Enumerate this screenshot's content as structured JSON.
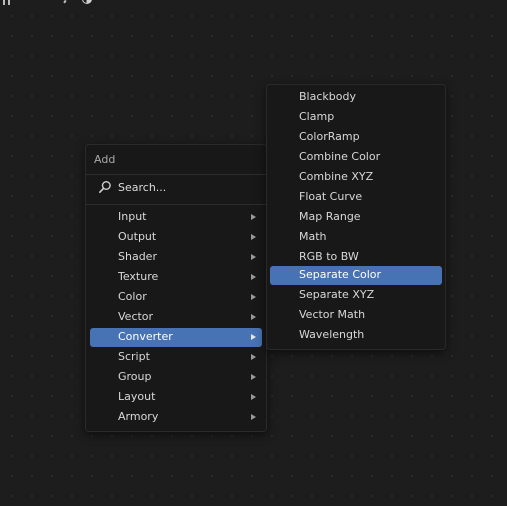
{
  "colors": {
    "background": "#1d1d1d",
    "menu_background": "#181818",
    "highlight": "#4772b3",
    "text": "#d8d8d8"
  },
  "add_menu": {
    "title": "Add",
    "search_label": "Search...",
    "search_icon": "search-icon",
    "items": [
      {
        "label": "Input",
        "has_submenu": true
      },
      {
        "label": "Output",
        "has_submenu": true
      },
      {
        "label": "Shader",
        "has_submenu": true
      },
      {
        "label": "Texture",
        "has_submenu": true
      },
      {
        "label": "Color",
        "has_submenu": true
      },
      {
        "label": "Vector",
        "has_submenu": true
      },
      {
        "label": "Converter",
        "has_submenu": true,
        "active": true
      },
      {
        "label": "Script",
        "has_submenu": true
      },
      {
        "label": "Group",
        "has_submenu": true
      },
      {
        "label": "Layout",
        "has_submenu": true
      },
      {
        "label": "Armory",
        "has_submenu": true
      }
    ]
  },
  "converter_menu": {
    "items": [
      {
        "label": "Blackbody"
      },
      {
        "label": "Clamp"
      },
      {
        "label": "ColorRamp"
      },
      {
        "label": "Combine Color"
      },
      {
        "label": "Combine XYZ"
      },
      {
        "label": "Float Curve"
      },
      {
        "label": "Map Range"
      },
      {
        "label": "Math"
      },
      {
        "label": "RGB to BW"
      },
      {
        "label": "Separate Color",
        "active": true
      },
      {
        "label": "Separate XYZ"
      },
      {
        "label": "Vector Math"
      },
      {
        "label": "Wavelength"
      }
    ]
  }
}
